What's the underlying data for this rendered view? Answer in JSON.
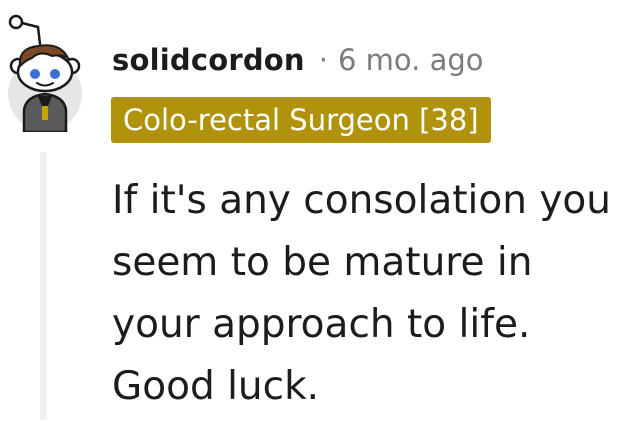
{
  "comment": {
    "username": "solidcordon",
    "separator": "·",
    "age": "6 mo. ago",
    "flair": "Colo-rectal Surgeon [38]",
    "body": "If it's any consolation you seem to be mature in your approach to life. Good luck."
  },
  "colors": {
    "flair_background": "#b0930a",
    "flair_text": "#ffffff",
    "thread_line": "#edeff1",
    "meta_text": "#7c7c7c",
    "body_text": "#1c1c1c"
  },
  "icons": {
    "avatar": "snoo-avatar-icon"
  }
}
